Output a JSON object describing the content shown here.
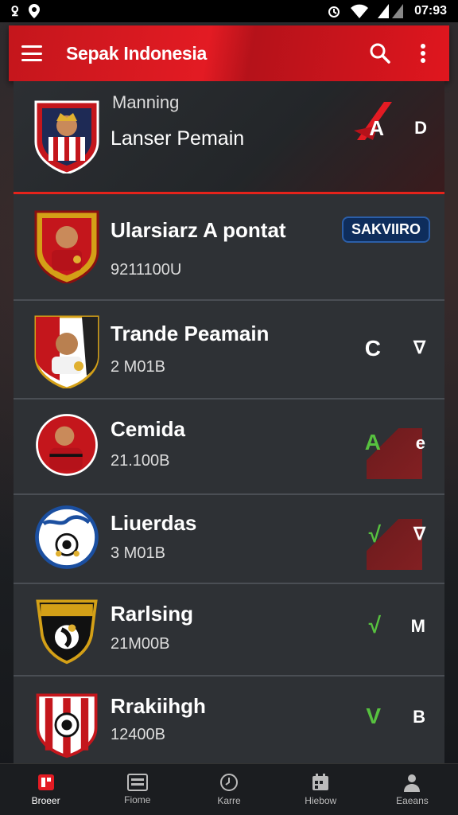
{
  "status": {
    "left_glyph": "ꝿ",
    "time": "07:93"
  },
  "appbar": {
    "title": "Sepak Indonesia"
  },
  "rows": [
    {
      "label": "Manning",
      "name": "Lanser Pemain",
      "sub": "",
      "act1": "A",
      "act2": "D"
    },
    {
      "label": "",
      "name": "Ularsiarz A pontat",
      "sub": "9211100U",
      "badge": "SAKVIIRO"
    },
    {
      "label": "",
      "name": "Trande Peamain",
      "sub": "2 M01B",
      "act1": "C",
      "act2": "∇"
    },
    {
      "label": "",
      "name": "Cemida",
      "sub": "21.100B",
      "act1": "A",
      "act2": "e"
    },
    {
      "label": "",
      "name": "Liuerdas",
      "sub": "3 M01B",
      "act1": "√",
      "act2": "∇"
    },
    {
      "label": "",
      "name": "Rarlsing",
      "sub": "21M00B",
      "act1": "√",
      "act2": "M"
    },
    {
      "label": "",
      "name": "Rrakiihgh",
      "sub": "12400B",
      "act1": "V",
      "act2": "B"
    }
  ],
  "nav": [
    {
      "label": "Broeer"
    },
    {
      "label": "Fiome"
    },
    {
      "label": "Karre"
    },
    {
      "label": "Hiebow"
    },
    {
      "label": "Eaeans"
    }
  ],
  "colors": {
    "accent": "#e31b23",
    "check_green": "#57c13f",
    "badge_blue": "#0e2d5c"
  }
}
